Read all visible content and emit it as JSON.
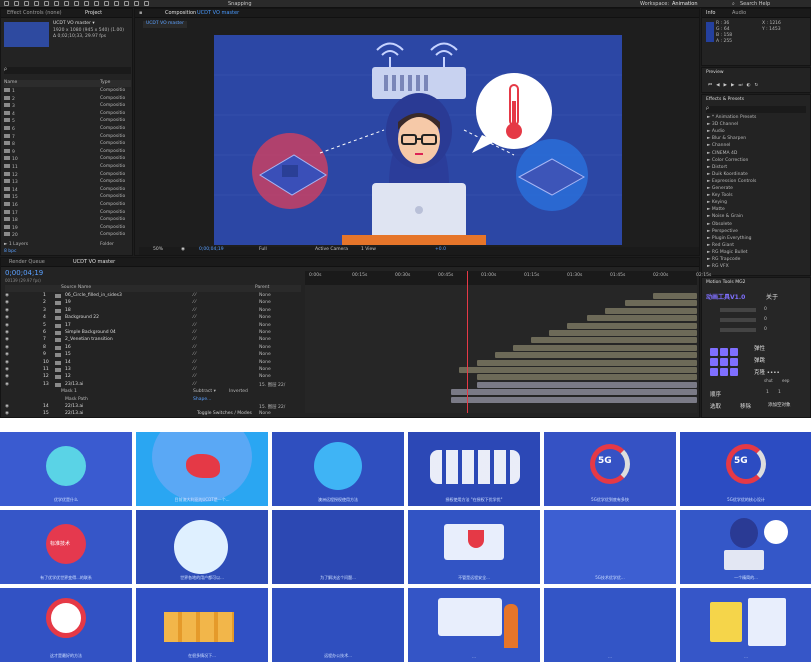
{
  "topbar": {
    "snapping_label": "Snapping",
    "workspace_label": "Workspace:",
    "workspace_value": "Animation",
    "search_placeholder": "Search Help"
  },
  "project_panel": {
    "tabs": [
      "Effect Controls (none)",
      "Project"
    ],
    "comp_name": "UCDT VO master ▾",
    "comp_info_1": "1920 x 1080  (945 x 540) (1.00)",
    "comp_info_2": "Δ 0;02;10;33, 29.97 fps",
    "col_name": "Name",
    "col_type": "Type",
    "items": [
      {
        "num": "1",
        "type": "Compositio"
      },
      {
        "num": "2",
        "type": "Compositio"
      },
      {
        "num": "3",
        "type": "Compositio"
      },
      {
        "num": "4",
        "type": "Compositio"
      },
      {
        "num": "5",
        "type": "Compositio"
      },
      {
        "num": "6",
        "type": "Compositio"
      },
      {
        "num": "7",
        "type": "Compositio"
      },
      {
        "num": "8",
        "type": "Compositio"
      },
      {
        "num": "9",
        "type": "Compositio"
      },
      {
        "num": "10",
        "type": "Compositio"
      },
      {
        "num": "11",
        "type": "Compositio"
      },
      {
        "num": "12",
        "type": "Compositio"
      },
      {
        "num": "13",
        "type": "Compositio"
      },
      {
        "num": "14",
        "type": "Compositio"
      },
      {
        "num": "15",
        "type": "Compositio"
      },
      {
        "num": "16",
        "type": "Compositio"
      },
      {
        "num": "17",
        "type": "Compositio"
      },
      {
        "num": "18",
        "type": "Compositio"
      },
      {
        "num": "19",
        "type": "Compositio"
      },
      {
        "num": "20",
        "type": "Compositio"
      }
    ],
    "layers_folder": "► 1 Layers",
    "layers_type": "Folder",
    "bpc": "8 bpc"
  },
  "comp_panel": {
    "tab_label": "Composition",
    "tab_comp": "UCDT VO master",
    "sub_tab": "UCDT VO master",
    "zoom": "50%",
    "timecode": "0;00;04;19",
    "resolution": "Full",
    "camera": "Active Camera",
    "views": "1 View",
    "offset": "+0.0"
  },
  "info_panel": {
    "tabs": [
      "Info",
      "Audio"
    ],
    "r": "R : 36",
    "g": "G : 64",
    "b": "B : 158",
    "a": "A : 255",
    "x": "X : 1216",
    "y": "Y : 1453"
  },
  "preview_panel": {
    "title": "Preview"
  },
  "effects_panel": {
    "title": "Effects & Presets",
    "search_placeholder": "ρ",
    "items": [
      "► * Animation Presets",
      "► 3D Channel",
      "► Audio",
      "► Blur & Sharpen",
      "► Channel",
      "► CINEMA 4D",
      "► Color Correction",
      "► Distort",
      "► Duik Koordinate",
      "► Expression Controls",
      "► Generate",
      "► Key Tools",
      "► Keying",
      "► Matte",
      "► Noise & Grain",
      "► Obsolete",
      "► Perspective",
      "► Plugin Everything",
      "► Red Giant",
      "► RG Magic Bullet",
      "► RG Trapcode",
      "► RG VFX"
    ]
  },
  "timeline": {
    "tabs": [
      "Render Queue",
      "UCDT VO master"
    ],
    "timecode": "0;00;04;19",
    "timecode_sub": "00139 (29.97 fps)",
    "col_source": "Source Name",
    "col_parent": "Parent",
    "toggle_label": "Toggle Switches / Modes",
    "time_ruler": [
      "0:00s",
      "00:15s",
      "00:30s",
      "00:45s",
      "01:00s",
      "01:15s",
      "01:30s",
      "01:45s",
      "02:00s",
      "02:15s"
    ],
    "layers": [
      {
        "num": "1",
        "name": "06_Circle_filled_in_sides3",
        "parent": "None"
      },
      {
        "num": "2",
        "name": "19",
        "parent": "None"
      },
      {
        "num": "3",
        "name": "18",
        "parent": "None"
      },
      {
        "num": "4",
        "name": "Background 22",
        "parent": "None"
      },
      {
        "num": "5",
        "name": "17",
        "parent": "None"
      },
      {
        "num": "6",
        "name": "Simple Background 04",
        "parent": "None"
      },
      {
        "num": "7",
        "name": "2_Venetian transition",
        "parent": "None"
      },
      {
        "num": "8",
        "name": "16",
        "parent": "None"
      },
      {
        "num": "9",
        "name": "15",
        "parent": "None"
      },
      {
        "num": "10",
        "name": "14",
        "parent": "None"
      },
      {
        "num": "11",
        "name": "13",
        "parent": "None"
      },
      {
        "num": "12",
        "name": "12",
        "parent": "None"
      },
      {
        "num": "13",
        "name": "23/13.ai",
        "parent": "15. 图层 22/"
      }
    ],
    "mask_label": "Mask 1",
    "mask_path": "Mask Path",
    "subtract_label": "Subtract ▾",
    "inverted_label": "Inverted",
    "shape_label": "Shape...",
    "extra_layers": [
      {
        "num": "14",
        "name": "22/13.ai",
        "parent": "15. 图层 22/"
      },
      {
        "num": "15",
        "name": "22/13.ai",
        "parent": "None"
      }
    ]
  },
  "motion_tools": {
    "title": "Motion Tools MG2",
    "brand": "动画工具V1.0",
    "close_label": "关于",
    "elastic_label": "弹性",
    "bounce_label": "弹跳",
    "clone_label": "克隆 ••••",
    "sort_label": "顺序",
    "select_label": "选取",
    "move_label": "移除",
    "null_label": "添加空对象",
    "num1": "1",
    "num2": "1",
    "val0": "0",
    "shut_label": "shut",
    "ease_label": "eep"
  },
  "tiles": {
    "row1": [
      {
        "center": "优学优是什么",
        "caption": "优学优是什么"
      },
      {
        "center": "",
        "caption": "目前澳大利亚的UCDT是一个..."
      },
      {
        "center": "",
        "caption": "澳洲远程授权使用方法"
      },
      {
        "center": "",
        "caption": "授权使用方法 \"在授权下优学优\""
      },
      {
        "center": "5G",
        "caption": "5G优学优到底有多快"
      },
      {
        "center": "5G",
        "caption": "5G优学优的核心设计"
      }
    ],
    "row2": [
      {
        "center": "标准技术",
        "caption": "有了优学优世界变得...的联系"
      },
      {
        "center": "",
        "caption": "世界各地的用户都可以..."
      },
      {
        "center": "",
        "caption": "为了解决这个问题..."
      },
      {
        "center": "",
        "caption": "不管是远程安全..."
      },
      {
        "center": "",
        "caption": "5G技术优学优..."
      },
      {
        "center": "",
        "caption": "一个精简的..."
      }
    ],
    "row3": [
      {
        "center": "",
        "caption": "这才是最好的方法"
      },
      {
        "center": "",
        "caption": "在很多情况下..."
      },
      {
        "center": "",
        "caption": "远程办公技术..."
      },
      {
        "center": "",
        "caption": "..."
      },
      {
        "center": "",
        "caption": "..."
      },
      {
        "center": "",
        "caption": "..."
      }
    ]
  },
  "colors": {
    "ae_bg": "#1d1d1d",
    "panel_bg": "#232323",
    "accent_blue": "#4a9bff",
    "scene_blue": "#2c47a5",
    "tile_blue": "#2e4aa0",
    "thermo_red": "#e53946",
    "timeline_bar": "#6d6a58"
  }
}
